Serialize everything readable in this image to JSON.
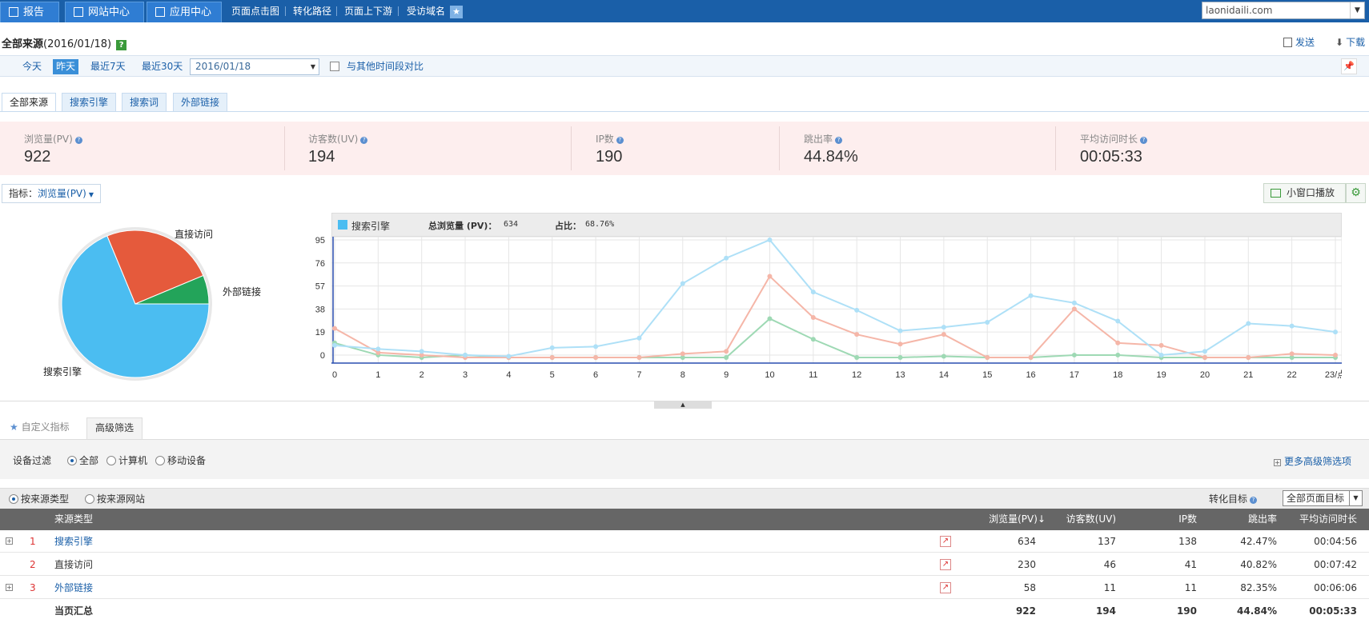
{
  "nav": {
    "report_label": "报告",
    "site_center_label": "网站中心",
    "app_center_label": "应用中心",
    "links": [
      "页面点击图",
      "转化路径",
      "页面上下游",
      "受访域名"
    ],
    "domain": "laonidaili.com"
  },
  "page": {
    "title": "全部来源",
    "date_suffix": "(2016/01/18)",
    "help": "?",
    "send_label": "发送",
    "download_label": "下载"
  },
  "datebar": {
    "buttons": [
      "今天",
      "昨天",
      "最近7天",
      "最近30天"
    ],
    "selected": "昨天",
    "date_value": "2016/01/18",
    "compare_label": "与其他时间段对比"
  },
  "tabs": [
    "全部来源",
    "搜索引擎",
    "搜索词",
    "外部链接"
  ],
  "kpi": [
    {
      "label": "浏览量(PV)",
      "value": "922"
    },
    {
      "label": "访客数(UV)",
      "value": "194"
    },
    {
      "label": "IP数",
      "value": "190"
    },
    {
      "label": "跳出率",
      "value": "44.84%"
    },
    {
      "label": "平均访问时长",
      "value": "00:05:33"
    }
  ],
  "metric": {
    "label": "指标：",
    "value": "浏览量(PV)"
  },
  "small_window_label": "小窗口播放",
  "pie": {
    "slices": [
      {
        "name": "搜索引擎",
        "value": 634,
        "color": "#4bbdf1"
      },
      {
        "name": "直接访问",
        "value": 230,
        "color": "#e55a3c"
      },
      {
        "name": "外部链接",
        "value": 58,
        "color": "#23a45a"
      }
    ]
  },
  "legend": {
    "series_name": "搜索引擎",
    "total_label": "总浏览量 (PV)：",
    "total_value": "634",
    "ratio_label": "占比：",
    "ratio_value": "68.76%"
  },
  "chart_data": {
    "type": "line",
    "x": [
      "0",
      "1",
      "2",
      "3",
      "4",
      "5",
      "6",
      "7",
      "8",
      "9",
      "10",
      "11",
      "12",
      "13",
      "14",
      "15",
      "16",
      "17",
      "18",
      "19",
      "20",
      "21",
      "22",
      "23/点"
    ],
    "yticks": [
      0,
      19,
      38,
      57,
      76,
      95
    ],
    "ylim": [
      -4,
      95
    ],
    "series": [
      {
        "name": "搜索引擎",
        "color": "#aee0f7",
        "values": [
          8,
          5,
          3,
          0,
          -1,
          6,
          7,
          14,
          59,
          80,
          95,
          52,
          37,
          20,
          23,
          27,
          49,
          43,
          28,
          0,
          3,
          26,
          24,
          19
        ]
      },
      {
        "name": "直接访问",
        "color": "#f5b6a8",
        "values": [
          22,
          2,
          0,
          -2,
          -2,
          -2,
          -2,
          -2,
          1,
          3,
          65,
          31,
          17,
          9,
          17,
          -2,
          -2,
          38,
          10,
          8,
          -2,
          -2,
          1,
          0
        ]
      },
      {
        "name": "外部链接",
        "color": "#9ed9b4",
        "values": [
          10,
          0,
          -2,
          0,
          -2,
          -2,
          -2,
          -2,
          -2,
          -2,
          30,
          13,
          -2,
          -2,
          -1,
          -2,
          -2,
          0,
          0,
          -2,
          -2,
          -2,
          -2,
          -2
        ]
      }
    ]
  },
  "filter": {
    "custom_label": "自定义指标",
    "advanced_label": "高级筛选",
    "device_label": "设备过滤",
    "device_options": [
      "全部",
      "计算机",
      "移动设备"
    ],
    "more_label": "更多高级筛选项",
    "group_options": [
      "按来源类型",
      "按来源网站"
    ],
    "goal_label": "转化目标",
    "goal_value": "全部页面目标"
  },
  "table": {
    "headers": [
      "来源类型",
      "浏览量(PV)",
      "访客数(UV)",
      "IP数",
      "跳出率",
      "平均访问时长"
    ],
    "rows": [
      {
        "idx": "1",
        "name": "搜索引擎",
        "pv": "634",
        "uv": "137",
        "ip": "138",
        "bounce": "42.47%",
        "dur": "00:04:56"
      },
      {
        "idx": "2",
        "name": "直接访问",
        "pv": "230",
        "uv": "46",
        "ip": "41",
        "bounce": "40.82%",
        "dur": "00:07:42"
      },
      {
        "idx": "3",
        "name": "外部链接",
        "pv": "58",
        "uv": "11",
        "ip": "11",
        "bounce": "82.35%",
        "dur": "00:06:06"
      }
    ],
    "total": {
      "label": "当页汇总",
      "pv": "922",
      "uv": "194",
      "ip": "190",
      "bounce": "44.84%",
      "dur": "00:05:33"
    }
  }
}
